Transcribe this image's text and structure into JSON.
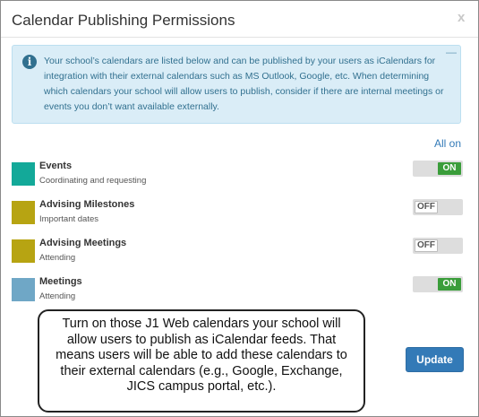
{
  "dialog": {
    "title": "Calendar Publishing Permissions",
    "close_label": "x"
  },
  "info": {
    "icon": "info-icon",
    "icon_glyph": "i",
    "collapse_label": "—",
    "text": "Your school’s calendars are listed below and can be published by your users as iCalendars for integration with their external calendars such as MS Outlook, Google, etc. When determining which calendars your school will allow users to publish, consider if there are internal meetings or events you don’t want available externally."
  },
  "all_on_label": "All on",
  "calendars": [
    {
      "name": "Events",
      "subtitle": "Coordinating and requesting",
      "color": "#13a999",
      "state": "ON"
    },
    {
      "name": "Advising Milestones",
      "subtitle": "Important dates",
      "color": "#b7a412",
      "state": "OFF"
    },
    {
      "name": "Advising Meetings",
      "subtitle": "Attending",
      "color": "#b7a412",
      "state": "OFF"
    },
    {
      "name": "Meetings",
      "subtitle": "Attending",
      "color": "#6fa7c6",
      "state": "ON"
    }
  ],
  "callout_text": "Turn on those J1 Web calendars your school will allow users to publish as iCalendar feeds. That means users will be able to add these calendars to their external calendars (e.g., Google, Exchange, JICS campus portal, etc.).",
  "update_label": "Update"
}
